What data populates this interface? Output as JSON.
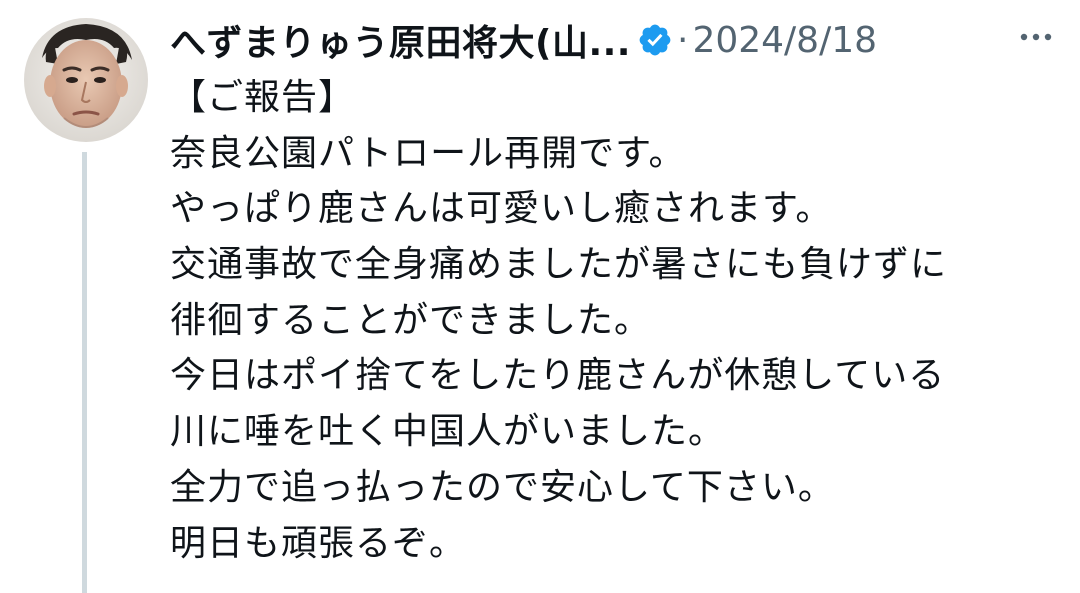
{
  "tweet": {
    "display_name": "へずまりゅう原田将大(山...",
    "separator": "·",
    "date": "2024/8/18",
    "body_lines": [
      "【ご報告】",
      "奈良公園パトロール再開です。",
      "やっぱり鹿さんは可愛いし癒されます。",
      "交通事故で全身痛めましたが暑さにも負けずに",
      "徘徊することができました。",
      "今日はポイ捨てをしたり鹿さんが休憩している",
      "川に唾を吐く中国人がいました。",
      "全力で追っ払ったので安心して下さい。",
      "明日も頑張るぞ。"
    ]
  },
  "icons": {
    "verified": "verified-badge-icon",
    "more": "more-options-icon"
  },
  "colors": {
    "text_primary": "#0f1419",
    "text_secondary": "#536471",
    "verified_blue": "#1d9bf0",
    "thread_line": "#cfd9de"
  }
}
